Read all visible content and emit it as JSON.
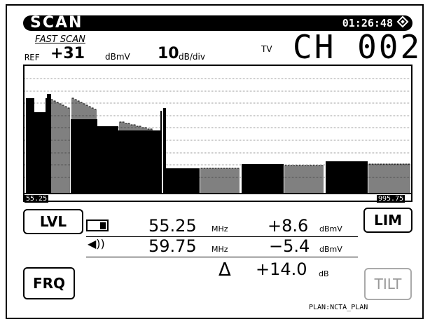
{
  "header": {
    "title": "SCAN",
    "time": "01:26:48"
  },
  "mode": "FAST SCAN",
  "ref": {
    "label": "REF",
    "value": "+31",
    "unit": "dBmV",
    "scale_value": "10",
    "scale_unit": "dB/div"
  },
  "channel": {
    "tv_label": "TV",
    "value": "CH 002"
  },
  "spectrum": {
    "start_marker": "55.25",
    "end_marker": "995.75"
  },
  "softkeys": {
    "lvl": "LVL",
    "lim": "LIM",
    "frq": "FRQ",
    "tilt": "TILT"
  },
  "readout": {
    "video_freq": "55.25",
    "video_freq_unit": "MHz",
    "video_level": "+8.6",
    "video_level_unit": "dBmV",
    "audio_freq": "59.75",
    "audio_freq_unit": "MHz",
    "audio_level": "−5.4",
    "audio_level_unit": "dBmV",
    "delta_symbol": "Δ",
    "delta_value": "+14.0",
    "delta_unit": "dB"
  },
  "plan": "PLAN:NCTA_PLAN"
}
